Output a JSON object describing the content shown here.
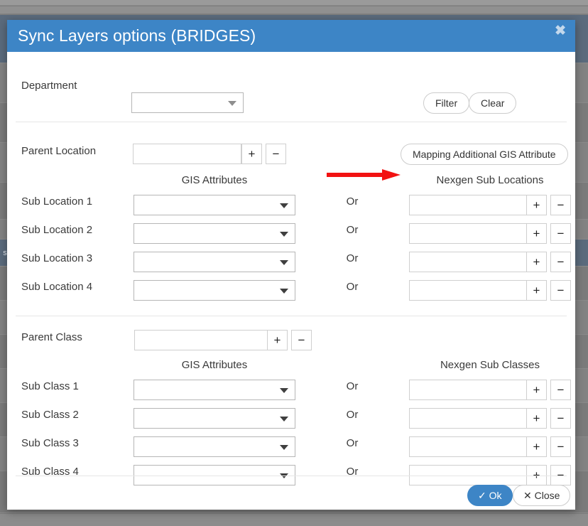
{
  "modal": {
    "title": "Sync Layers options (BRIDGES)",
    "close_icon": "close-icon",
    "close_glyph": "✖"
  },
  "department_row": {
    "label": "Department",
    "dropdown_value": "",
    "filter_label": "Filter",
    "clear_label": "Clear"
  },
  "locations_section": {
    "parent_label": "Parent Location",
    "parent_value": "",
    "add_label": "+",
    "remove_label": "−",
    "mapping_button_label": "Mapping Additional GIS Attribute",
    "gis_header": "GIS Attributes",
    "nexgen_header": "Nexgen Sub Locations",
    "or_label": "Or",
    "rows": [
      {
        "label": "Sub Location 1",
        "gis_value": "",
        "nexgen_value": ""
      },
      {
        "label": "Sub Location 2",
        "gis_value": "",
        "nexgen_value": ""
      },
      {
        "label": "Sub Location 3",
        "gis_value": "",
        "nexgen_value": ""
      },
      {
        "label": "Sub Location 4",
        "gis_value": "",
        "nexgen_value": ""
      }
    ]
  },
  "classes_section": {
    "parent_label": "Parent Class",
    "parent_value": "",
    "add_label": "+",
    "remove_label": "−",
    "gis_header": "GIS Attributes",
    "nexgen_header": "Nexgen Sub Classes",
    "or_label": "Or",
    "rows": [
      {
        "label": "Sub Class 1",
        "gis_value": "",
        "nexgen_value": ""
      },
      {
        "label": "Sub Class 2",
        "gis_value": "",
        "nexgen_value": ""
      },
      {
        "label": "Sub Class 3",
        "gis_value": "",
        "nexgen_value": ""
      },
      {
        "label": "Sub Class 4",
        "gis_value": "",
        "nexgen_value": ""
      }
    ]
  },
  "footer": {
    "ok_label": "Ok",
    "ok_icon_glyph": "✓",
    "close_label": "Close",
    "close_icon_glyph": "✕"
  },
  "annotation": {
    "arrow_color": "#f21212",
    "points_to": "Mapping Additional GIS Attribute"
  },
  "colors": {
    "header_blue": "#3d85c6",
    "primary_button": "#3d85c6",
    "backdrop_gray": "#7d7d7d",
    "selected_row": "#5b6b7d"
  },
  "background": {
    "selected_marker_text": "s"
  }
}
